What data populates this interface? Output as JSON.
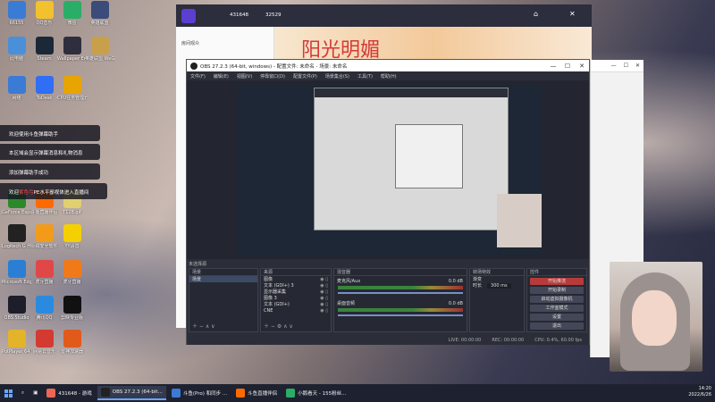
{
  "desktop": {
    "icons": [
      {
        "label": "66155",
        "color": "#3a7bd5"
      },
      {
        "label": "QQ音乐",
        "color": "#f2c12e"
      },
      {
        "label": "微信",
        "color": "#2aae67"
      },
      {
        "label": "英雄联盟",
        "color": "#3b4b7a"
      },
      {
        "label": "此电脑",
        "color": "#4a90d9"
      },
      {
        "label": "Steam",
        "color": "#1b2838"
      },
      {
        "label": "Wallpaper Engine",
        "color": "#2e2e3e"
      },
      {
        "label": "英雄联盟 WeGame版",
        "color": "#c8a04a"
      },
      {
        "label": "网络",
        "color": "#3a7bd5"
      },
      {
        "label": "ToDesk",
        "color": "#2f6ef5"
      },
      {
        "label": "CPU任务管理器",
        "color": "#e8a400"
      },
      {
        "label": "GeForce Experience",
        "color": "#2a8a2a"
      },
      {
        "label": "斗鱼直播伴侣",
        "color": "#ff6a00"
      },
      {
        "label": "T128.gif",
        "color": "#e0d070"
      },
      {
        "label": "Logitech G HUB",
        "color": "#222"
      },
      {
        "label": "火绒安全软件",
        "color": "#f29b1a"
      },
      {
        "label": "YY语音",
        "color": "#f5d000"
      },
      {
        "label": "Microsoft Edge",
        "color": "#2a7fd4"
      },
      {
        "label": "虎牙直播",
        "color": "#e04848"
      },
      {
        "label": "虎牙直播",
        "color": "#f07a1a"
      },
      {
        "label": "OBS Studio",
        "color": "#1e1e2a"
      },
      {
        "label": "腾讯QQ",
        "color": "#2a8ae0"
      },
      {
        "label": "剪映专业版",
        "color": "#111"
      },
      {
        "label": "PotPlayer 64 bit",
        "color": "#e3b32a"
      },
      {
        "label": "网易云音乐",
        "color": "#d33a31"
      },
      {
        "label": "雷神加速器",
        "color": "#e25a1a"
      }
    ],
    "notifications": [
      {
        "text": "欢迎使用斗鱼弹幕助手"
      },
      {
        "text": "本区域会显示弹幕消息和礼物消息"
      },
      {
        "text": "添加弹幕助手成功"
      }
    ],
    "gift_notice": {
      "pre": "欢迎",
      "name": "紫色弓",
      "post": "PE水平鄙视体进入直播间"
    }
  },
  "back_app": {
    "stats": [
      "431648",
      "32529"
    ],
    "left_label": "房间观众",
    "banner_text": "阳光明媚"
  },
  "obs": {
    "title": "OBS 27.2.3 (64-bit, windows) - 配置文件: 未命名 - 场景: 未命名",
    "menu": [
      "文件(F)",
      "编辑(E)",
      "视图(V)",
      "停靠窗口(D)",
      "配置文件(P)",
      "场景集合(S)",
      "工具(T)",
      "帮助(H)"
    ],
    "dock_headers": [
      "场景",
      "来源",
      "混音器",
      "转场特效",
      "控件"
    ],
    "scenes": [
      "场景"
    ],
    "sources": [
      {
        "name": "图像"
      },
      {
        "name": "文本 (GDI+) 3"
      },
      {
        "name": "显示器采集"
      },
      {
        "name": "图像 3"
      },
      {
        "name": "文本 (GDI+)"
      },
      {
        "name": "CNE"
      }
    ],
    "mixer": [
      {
        "name": "麦克风/Aux",
        "db": "0.0 dB"
      },
      {
        "name": "桌面音频",
        "db": "0.0 dB"
      }
    ],
    "transition": {
      "type": "渐变",
      "duration_label": "时长",
      "duration": "300 ms"
    },
    "controls": [
      "开始推流",
      "开始录制",
      "启动虚拟摄像机",
      "工作室模式",
      "设置",
      "退出"
    ],
    "status": {
      "live": "LIVE: 00:00:00",
      "rec": "REC: 00:00:00",
      "cpu": "CPU: 0.4%, 60.00 fps"
    },
    "preview_label": "未选择源"
  },
  "taskbar": {
    "items": [
      {
        "label": "431648 - 游戏",
        "color": "#e65"
      },
      {
        "label": "OBS 27.2.3 (64-bit...",
        "color": "#222"
      },
      {
        "label": "斗鱼(Pro) 和同步 ...",
        "color": "#3a7bd5"
      },
      {
        "label": "斗鱼直播伴侣",
        "color": "#ff6a00"
      },
      {
        "label": "小鹅看天 - 155粉丝...",
        "color": "#2aae67"
      }
    ],
    "time": "14:20",
    "date": "2022/6/26"
  },
  "colors": {
    "accent": "#6aa6ff",
    "obs_bg": "#2b2e38",
    "record": "#b73b3b"
  }
}
